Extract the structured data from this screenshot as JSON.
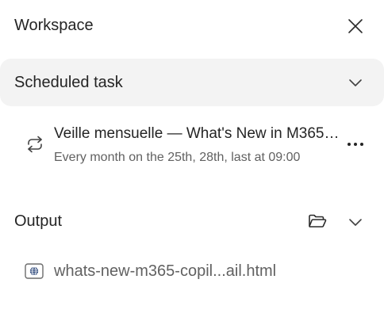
{
  "header": {
    "title": "Workspace",
    "close_icon": "close-icon"
  },
  "scheduled_section": {
    "title": "Scheduled task",
    "expanded": true,
    "task": {
      "title": "Veille mensuelle — What's New in M365 Copilot",
      "schedule": "Every month on the 25th, 28th, last at 09:00",
      "icon": "recurring-icon",
      "more_icon": "more-horizontal-icon"
    }
  },
  "output_section": {
    "title": "Output",
    "expanded": true,
    "folder_icon": "folder-open-icon",
    "file": {
      "name": "whats-new-m365-copil...ail.html",
      "icon": "web-file-icon"
    }
  }
}
